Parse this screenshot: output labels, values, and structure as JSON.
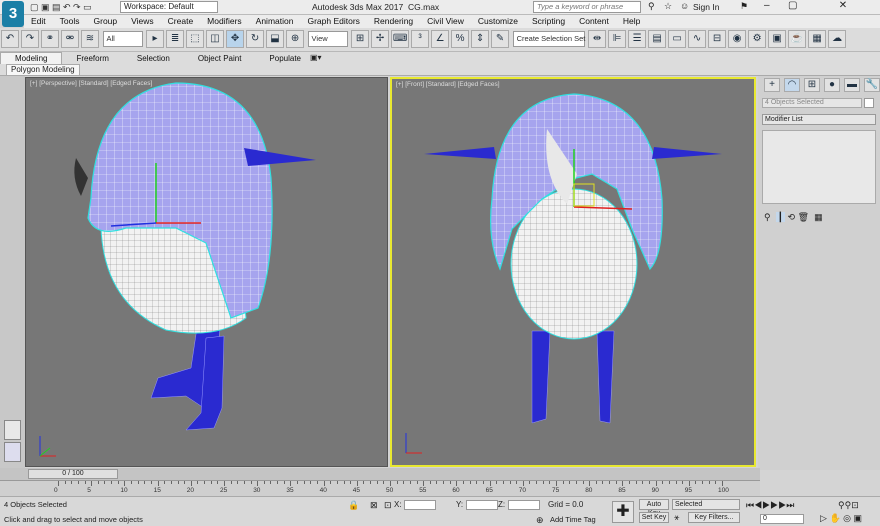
{
  "title": {
    "workspace_label": "Workspace: Default",
    "app_title": "Autodesk 3ds Max 2017",
    "file_name": "CG.max",
    "search_placeholder": "Type a keyword or phrase",
    "sign_in": "Sign In"
  },
  "menu": [
    "Edit",
    "Tools",
    "Group",
    "Views",
    "Create",
    "Modifiers",
    "Animation",
    "Graph Editors",
    "Rendering",
    "Civil View",
    "Customize",
    "Scripting",
    "Content",
    "Help"
  ],
  "toolbar": {
    "filter_value": "All",
    "refcoord_value": "View",
    "selection_set": "Create Selection Set"
  },
  "ribbon": {
    "tabs": [
      "Modeling",
      "Freeform",
      "Selection",
      "Object Paint",
      "Populate"
    ],
    "active": "Modeling",
    "sub_button": "Polygon Modeling"
  },
  "viewports": {
    "left_label": "[+] [Perspective] [Standard] [Edged Faces]",
    "right_label": "[+] [Front] [Standard] [Edged Faces]"
  },
  "command_panel": {
    "selection_name": "4 Objects Selected",
    "modifier_list": "Modifier List"
  },
  "timeline": {
    "frame_readout": "0 / 100",
    "ticks": [
      "0",
      "5",
      "10",
      "15",
      "20",
      "25",
      "30",
      "35",
      "40",
      "45",
      "50",
      "55",
      "60",
      "65",
      "70",
      "75",
      "80",
      "85",
      "90",
      "95",
      "100"
    ]
  },
  "status": {
    "objects_selected": "4 Objects Selected",
    "prompt": "Click and drag to select and move objects",
    "x_label": "X:",
    "y_label": "Y:",
    "z_label": "Z:",
    "grid": "Grid = 0.0",
    "add_time_tag": "Add Time Tag",
    "auto_key": "Auto Key",
    "set_key": "Set Key",
    "selected": "Selected",
    "key_filters": "Key Filters...",
    "frame_value": "0"
  },
  "colors": {
    "viewport_bg": "#777777",
    "active_border": "#e8e830",
    "hair": "#a6a4ee",
    "legs": "#2a2ad0",
    "selection": "#30e0e0"
  }
}
